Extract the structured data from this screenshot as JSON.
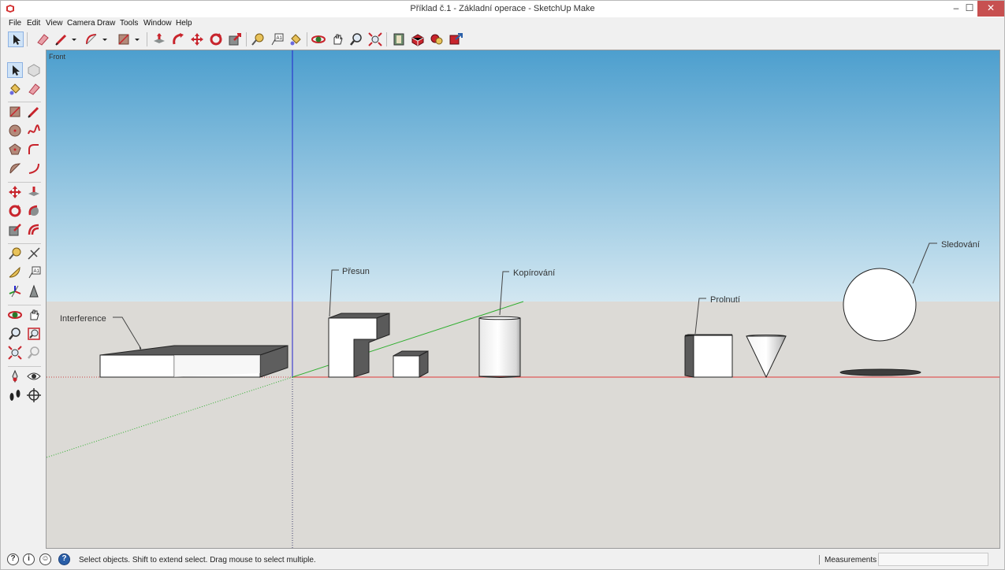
{
  "window": {
    "title": "Příklad č.1 - Základní operace - SketchUp Make",
    "minimize": "–",
    "maximize": "☐",
    "close": "✕"
  },
  "menu": [
    "File",
    "Edit",
    "View",
    "Camera",
    "Draw",
    "Tools",
    "Window",
    "Help"
  ],
  "toolbar_icons": [
    "select-tool-icon",
    "eraser-icon",
    "pencil-icon",
    "dropdown-arrow-icon",
    "arc-icon",
    "dropdown-arrow-icon",
    "rectangle-icon",
    "dropdown-arrow-icon",
    "push-pull-icon",
    "follow-me-icon",
    "move-icon",
    "rotate-icon",
    "scale-icon",
    "tape-measure-icon",
    "text-label-icon",
    "paint-bucket-icon",
    "orbit-icon",
    "pan-icon",
    "zoom-icon",
    "zoom-extents-icon",
    "warehouse-icon",
    "extension-warehouse-icon",
    "components-icon",
    "share-model-icon"
  ],
  "scene": {
    "view_label": "Front",
    "labels": {
      "interference": "Interference",
      "move": "Přesun",
      "copy": "Kopírování",
      "intersect": "Prolnutí",
      "follow": "Sledování"
    }
  },
  "status": {
    "help_icons": [
      "question-icon",
      "info-icon",
      "user-icon",
      "help-circle-icon"
    ],
    "message": "Select objects. Shift to extend select. Drag mouse to select multiple.",
    "measurements_label": "Measurements",
    "measurements_value": ""
  },
  "colors": {
    "sky_top": "#4d9fce",
    "sky_bottom": "#d2e7f1",
    "ground": "#dcdad6",
    "axis_red": "#e03a3a",
    "axis_green": "#2fae2f",
    "axis_blue": "#2222cc",
    "shade": "#5a5a5a",
    "tool_red": "#c8242c"
  }
}
